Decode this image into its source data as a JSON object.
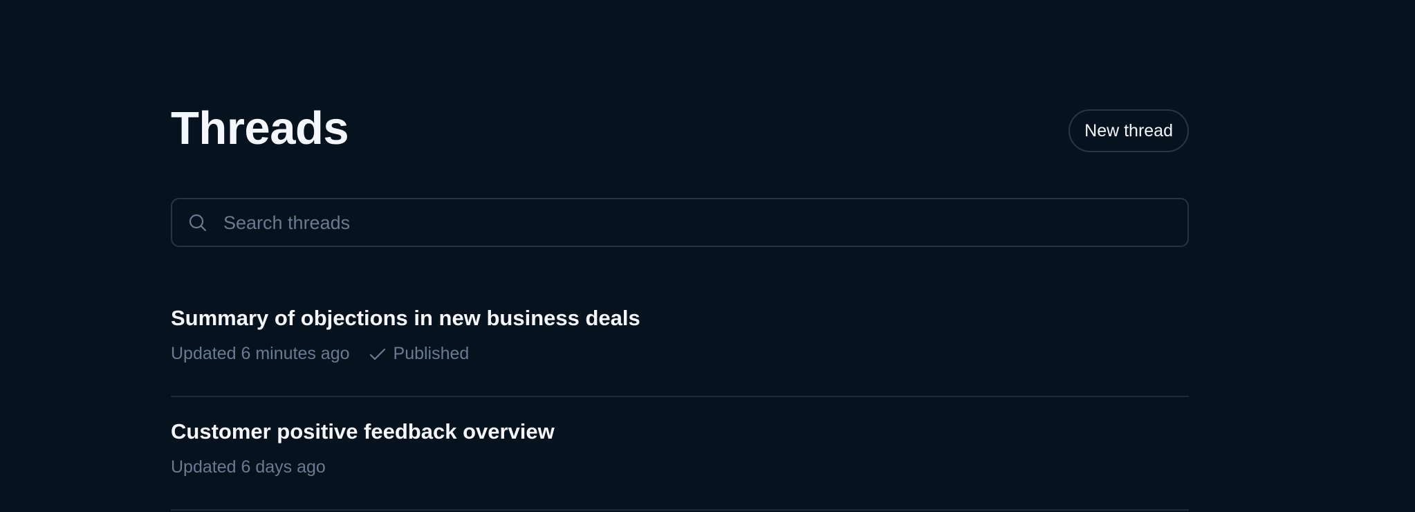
{
  "page": {
    "title": "Threads",
    "new_thread_label": "New thread"
  },
  "search": {
    "placeholder": "Search threads",
    "icon": "search-icon"
  },
  "threads": [
    {
      "title": "Summary of objections in new business deals",
      "updated": "Updated 6 minutes ago",
      "status": "Published",
      "status_icon": "check-icon"
    },
    {
      "title": "Customer positive feedback overview",
      "updated": "Updated 6 days ago"
    }
  ],
  "colors": {
    "background": "#07121f",
    "text_primary": "#f3f6fa",
    "text_muted": "#6b7a8e",
    "border": "#283442"
  }
}
